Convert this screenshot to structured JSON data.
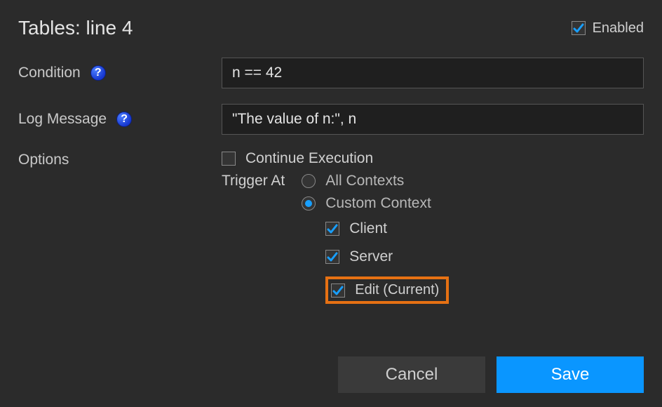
{
  "header": {
    "title": "Tables: line 4",
    "enabled_label": "Enabled",
    "enabled_checked": true
  },
  "condition": {
    "label": "Condition",
    "value": "n == 42"
  },
  "log_message": {
    "label": "Log Message",
    "value": "\"The value of n:\", n"
  },
  "options": {
    "label": "Options",
    "continue_label": "Continue Execution",
    "continue_checked": false,
    "trigger_label": "Trigger At",
    "radios": {
      "all_label": "All Contexts",
      "all_selected": false,
      "custom_label": "Custom Context",
      "custom_selected": true
    },
    "contexts": {
      "client_label": "Client",
      "client_checked": true,
      "server_label": "Server",
      "server_checked": true,
      "edit_label": "Edit (Current)",
      "edit_checked": true
    }
  },
  "buttons": {
    "cancel": "Cancel",
    "save": "Save"
  }
}
